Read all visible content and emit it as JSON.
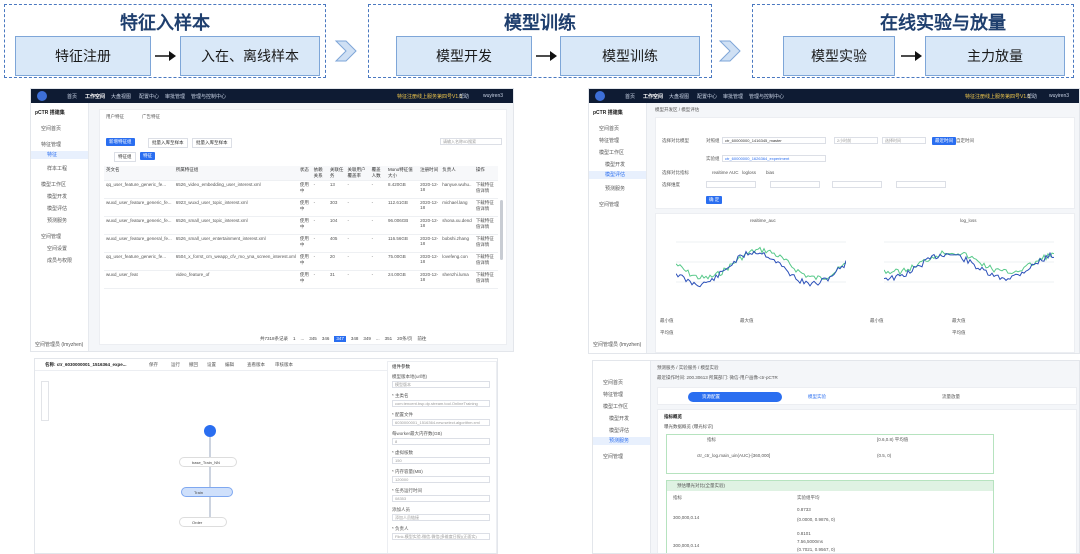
{
  "stages": [
    {
      "title": "特征入样本",
      "boxes": [
        "特征注册",
        "入在、离线样本"
      ]
    },
    {
      "title": "模型训练",
      "boxes": [
        "模型开发",
        "模型训练"
      ]
    },
    {
      "title": "在线实验与放量",
      "boxes": [
        "模型实验",
        "主力放量"
      ]
    }
  ],
  "nav": {
    "items": [
      "首页",
      "工作空间",
      "大盘视图",
      "配置中心",
      "审批管理",
      "管理与控制中心"
    ],
    "notice": "特征注册线上服务第四号V1.0",
    "help": "帮助",
    "user": "wuyiren3",
    "project": "pCTR 搭建集"
  },
  "s1": {
    "sidebar": [
      "空间首页",
      "特征管理",
      "特征",
      "样本工程",
      "模型工作区",
      "模型开发",
      "模型评估",
      "预测服务",
      "空间管理",
      "空间设置",
      "成员与权限"
    ],
    "tabs": [
      "用户特征",
      "广告特征"
    ],
    "buttons": [
      "新增特征组",
      "批量入库至样本",
      "批量入库至样本"
    ],
    "subtabs": [
      "特征组",
      "特征"
    ],
    "search_placeholder": "请输入名称/ID搜索",
    "headers": [
      "英文名",
      "所属特征组",
      "状态",
      "依赖关系",
      "关联任务",
      "关联用户覆盖率",
      "覆盖人数",
      "Mono特征值大小",
      "注册时间",
      "负责人",
      "操作"
    ],
    "rows": [
      [
        "qq_user_feature_generic_fe...",
        "6526_video_embedding_user_interest.xml",
        "使用中",
        "-",
        "13",
        "-",
        "-",
        "8.420GB",
        "2020-12-18",
        "hanyue.wuhu..",
        "下载特征值详情"
      ],
      [
        "wuxd_user_feature_generic_fe...",
        "6923_wuxd_user_topic_interest.xml",
        "使用中",
        "-",
        "303",
        "-",
        "-",
        "112.61GB",
        "2020-12-18",
        "michael.lang",
        "下载特征值详情"
      ],
      [
        "wuxd_user_feature_generic_fe...",
        "6526_small_user_topic_interest.xml",
        "使用中",
        "-",
        "104",
        "-",
        "-",
        "96.006GB",
        "2020-12-18",
        "shona.xu.dend",
        "下载特征值详情"
      ],
      [
        "wuxd_user_feature_general_fe...",
        "6526_small_user_entertainment_interest.xml",
        "使用中",
        "-",
        "405",
        "-",
        "-",
        "116.56GB",
        "2020-12-18",
        "bobshi.zhang",
        "下载特征值详情"
      ],
      [
        "qq_user_feature_generic_fe...",
        "6504_x_forrst_cm_weapp_cfv_mo_yna_screen_interest.xml",
        "使用中",
        "-",
        "20",
        "-",
        "-",
        "75.00GB",
        "2020-12-18",
        "lovefeng.con",
        "下载特征值详情"
      ],
      [
        "wuxd_user_feat",
        "video_feature_of",
        "使用中",
        "-",
        "31",
        "-",
        "-",
        "24.00GB",
        "2020-12-18",
        "shenzhi.luma",
        "下载特征值详情"
      ]
    ],
    "pager": [
      "共7318条记录",
      "1",
      "...",
      "345",
      "346",
      "347",
      "348",
      "349",
      "...",
      "351",
      "20条/页",
      "前往"
    ],
    "footer": "空间管理员 (lmyzhen)"
  },
  "s2": {
    "breadcrumb": "模型开发区 / 模型评估",
    "sidebar": [
      "空间首页",
      "特征管理",
      "模型工作区",
      "模型开发",
      "模型评估",
      "预测服务",
      "空间管理"
    ],
    "form": {
      "base_label": "选择对比模型",
      "base_tag": "对照组",
      "base_value": "ctr_60000000_1416345_master",
      "base_time": "2小时前",
      "base_ref": "选择时间",
      "base_btn": "最近时间",
      "base_btn2": "自定时间",
      "exp_tag": "实验组",
      "exp_value": "ctr_60000000_1626364_experiment",
      "metric_label": "选择对比指标",
      "metrics": [
        "realtime AUC",
        "logloss",
        "bias"
      ],
      "dim_label": "选择维度",
      "confirm": "确 定"
    },
    "charts": [
      {
        "title": "realtime_auc"
      },
      {
        "title": "log_loss"
      }
    ],
    "footer": "空间管理员 (lmyzhen)",
    "stat_labels": [
      "最小值",
      "最大值",
      "平均值",
      "最小值",
      "最大值",
      "平均值"
    ]
  },
  "s3": {
    "title": "名称: ctr_6030000001_1516364_expe...",
    "toolbar": [
      "保存",
      "运行",
      "撤回",
      "设置",
      "编辑",
      "查看版本",
      "审核版本"
    ],
    "nodes": [
      "base_Train_NN",
      "Train",
      "Order"
    ],
    "config_title": "组件参数",
    "fields": [
      {
        "label": "模型版本地(url地)",
        "value": "模型版本"
      },
      {
        "label": "* 主类名",
        "value": "com.tencent.bsp.dp.stream.tool.OnlineTraining"
      },
      {
        "label": "* 配置文件",
        "value": "6030000001_1516364.new.select.algorithm.xml"
      },
      {
        "label": "每worker最大内存数(GB)",
        "value": "8"
      },
      {
        "label": "* 虚拟核数",
        "value": "150"
      },
      {
        "label": "* 内存容量(MB)",
        "value": "120000"
      },
      {
        "label": "* 任务运行时间",
        "value": "08353"
      },
      {
        "label": "添加人员",
        "value": "添加人员链接"
      },
      {
        "label": "* 负责人",
        "value": "Flink-模型实验-微信-微信(多维度日报)(正面实)"
      }
    ]
  },
  "s4": {
    "breadcrumb": "预测服务 / 实验服务 / 模型实验",
    "info": "最近操作时间: 200.30613    所属部门: 微信-用户画像-ctr-pCTR",
    "steps": [
      "资源配置",
      "模型实验",
      "流量放量"
    ],
    "sidebar": [
      "空间首页",
      "特征管理",
      "模型工作区",
      "模型开发",
      "模型评估",
      "预测服务",
      "空间管理"
    ],
    "section": "指标概览",
    "subtitle": "曝光数据概览 (曝光标识)",
    "table_headers": [
      "指标",
      "[0.6,0.8) 平均值"
    ],
    "rows": [
      [
        "ctr_ctr_log.main_uin(AUC)-[360,000]",
        "(0.5, 0)"
      ]
    ],
    "section2": "预估曝光对比(全量实验)",
    "table2_headers": [
      "指标",
      "实验组平均"
    ],
    "rows2": [
      [
        "300,000,0.14",
        "0.8733",
        "(0.0000, 0.9876, 0)"
      ],
      [
        "300,000,0.14",
        "0.8101",
        "7.56,5000ms",
        "(0.7021, 0.9567, 0)"
      ]
    ]
  },
  "colors": {
    "dashed": "#4a78c0",
    "box": "#d9e8f8",
    "dark": "#0e1b33",
    "primary": "#2a6ef0",
    "green": "#3bb54a"
  }
}
